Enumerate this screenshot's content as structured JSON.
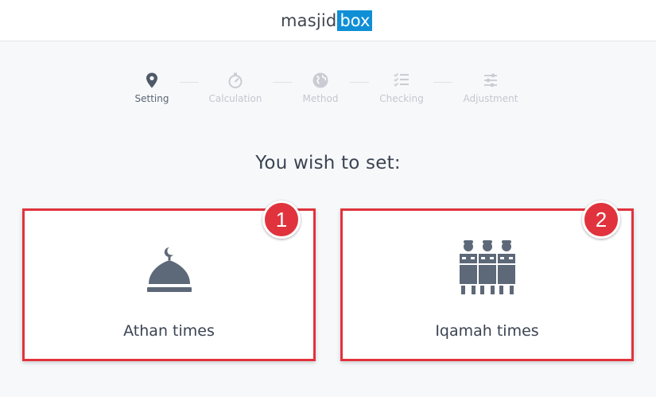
{
  "header": {
    "logo_text": "masjid",
    "logo_box": "box",
    "brand_color": "#0f8fd6"
  },
  "stepper": {
    "steps": [
      {
        "label": "Setting",
        "icon": "map-pin-icon",
        "active": true
      },
      {
        "label": "Calculation",
        "icon": "stopwatch-icon",
        "active": false
      },
      {
        "label": "Method",
        "icon": "globe-icon",
        "active": false
      },
      {
        "label": "Checking",
        "icon": "checklist-icon",
        "active": false
      },
      {
        "label": "Adjustment",
        "icon": "sliders-icon",
        "active": false
      }
    ]
  },
  "main": {
    "heading": "You wish to set:",
    "options": [
      {
        "label": "Athan times",
        "icon": "mosque-dome-icon",
        "badge": "1"
      },
      {
        "label": "Iqamah times",
        "icon": "praying-people-icon",
        "badge": "2"
      }
    ]
  },
  "colors": {
    "highlight": "#e0333d",
    "active_text": "#5b6574",
    "inactive": "#c3c7cf",
    "icon_fill": "#5d6878"
  }
}
